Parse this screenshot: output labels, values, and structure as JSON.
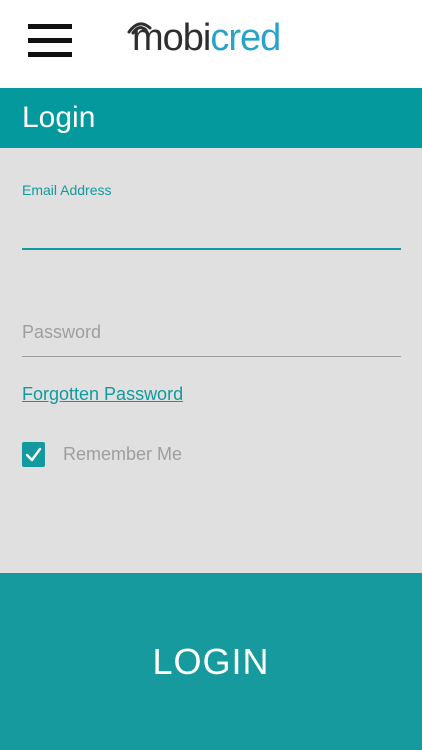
{
  "header": {
    "logo_text_dark": "mobi",
    "logo_text_accent": "cred",
    "menu_icon": "hamburger-menu-icon"
  },
  "page": {
    "title": "Login"
  },
  "form": {
    "email_label": "Email Address",
    "email_value": "",
    "password_placeholder": "Password",
    "password_value": "",
    "forgot_password_label": "Forgotten Password",
    "remember_me_label": "Remember Me",
    "remember_me_checked": true
  },
  "actions": {
    "login_label": "LOGIN"
  },
  "colors": {
    "primary": "#04999c",
    "accent_text": "#129a9e",
    "logo_accent": "#2aa3c9",
    "background": "#e0e0e0"
  }
}
